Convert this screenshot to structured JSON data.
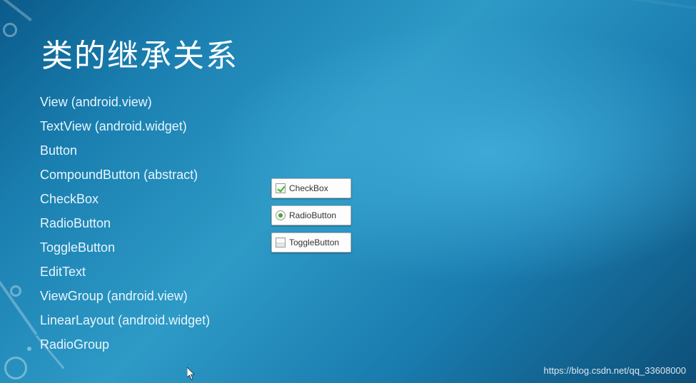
{
  "title": "类的继承关系",
  "tree": {
    "n0": "View (android.view)",
    "n1": "TextView (android.widget)",
    "n2": "Button",
    "n3": "CompoundButton (abstract)",
    "n4": "CheckBox",
    "n5": "RadioButton",
    "n6": "ToggleButton",
    "n7": "EditText",
    "n8": "ViewGroup (android.view)",
    "n9": "LinearLayout (android.widget)",
    "n10": "RadioGroup"
  },
  "widgets": {
    "checkbox_label": "CheckBox",
    "radiobutton_label": "RadioButton",
    "togglebutton_label": "ToggleButton"
  },
  "watermark": "https://blog.csdn.net/qq_33608000"
}
